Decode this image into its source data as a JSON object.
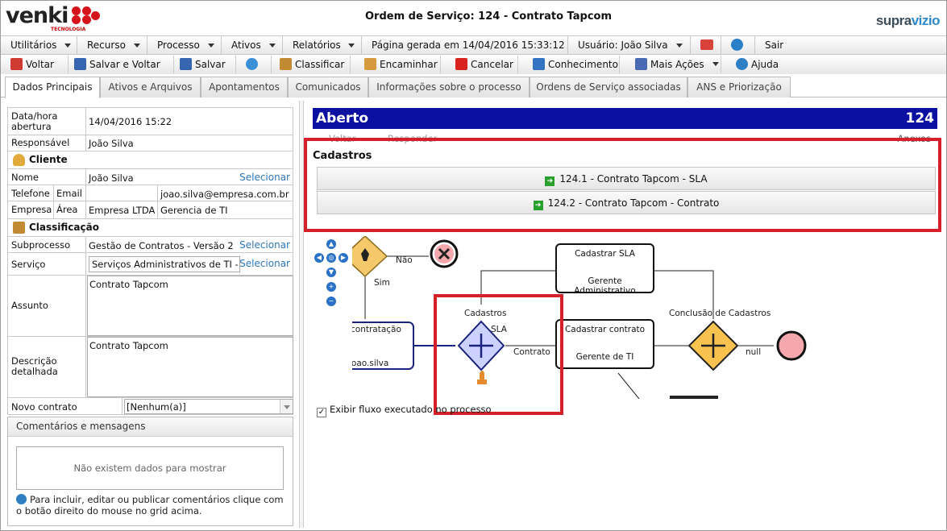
{
  "header": {
    "logo_text": "venki",
    "logo_sub": "TECNOLOGIA",
    "title": "Ordem de Serviço: 124 - Contrato Tapcom",
    "brand_a": "supra",
    "brand_b": "vizio"
  },
  "menu": {
    "items": [
      "Utilitários",
      "Recurso",
      "Processo",
      "Ativos",
      "Relatórios"
    ],
    "generated": "Página gerada em 14/04/2016 15:33:12",
    "user": "Usuário: João Silva",
    "exit": "Sair"
  },
  "toolbar": {
    "voltar": "Voltar",
    "salvar_voltar": "Salvar e Voltar",
    "salvar": "Salvar",
    "classificar": "Classificar",
    "encaminhar": "Encaminhar",
    "cancelar": "Cancelar",
    "conhecimento": "Conhecimento",
    "mais_acoes": "Mais Ações",
    "ajuda": "Ajuda"
  },
  "tabs": [
    "Dados Principais",
    "Ativos e Arquivos",
    "Apontamentos",
    "Comunicados",
    "Informações sobre o processo",
    "Ordens de Serviço associadas",
    "ANS e Priorização"
  ],
  "form": {
    "data_label": "Data/hora abertura",
    "data_value": "14/04/2016 15:22",
    "resp_label": "Responsável",
    "resp_value": "João Silva",
    "cliente": "Cliente",
    "nome_label": "Nome",
    "nome_value": "João Silva",
    "selecionar": "Selecionar",
    "tel_label": "Telefone",
    "email_label": "Email",
    "email_value": "joao.silva@empresa.com.br",
    "empresa_label": "Empresa",
    "area_label": "Área",
    "empresa_value": "Empresa LTDA",
    "area_value": "Gerencia de TI",
    "classificacao": "Classificação",
    "sub_label": "Subprocesso",
    "sub_value": "Gestão de Contratos - Versão 2",
    "serv_label": "Serviço",
    "serv_value": "Serviços Administrativos de TI -",
    "assunto_label": "Assunto",
    "assunto_value": "Contrato Tapcom",
    "desc_label": "Descrição detalhada",
    "desc_value": "Contrato Tapcom",
    "novo_label": "Novo contrato",
    "novo_value": "[Nenhum(a)]"
  },
  "comments": {
    "title": "Comentários e mensagens",
    "empty": "Não existem dados para mostrar",
    "hint": "Para incluir, editar ou publicar comentários clique com o botão direito do mouse no grid acima."
  },
  "panel": {
    "status": "Aberto",
    "number": "124",
    "voltar": "Voltar",
    "responder": "Responder",
    "anexos": "Anexos",
    "section": "Cadastros",
    "options": [
      "124.1 - Contrato Tapcom - SLA",
      "124.2 - Contrato Tapcom - Contrato"
    ]
  },
  "diagram": {
    "nao": "Não",
    "sim": "Sim",
    "cadastros": "Cadastros",
    "sla": "SLA",
    "contrato": "Contrato",
    "null": "null",
    "conclusao": "Conclusão de Cadastros",
    "task1_title": "Cadastrar SLA",
    "task1_role": "Gerente Administrativo",
    "task2_title": "Cadastrar contrato",
    "task2_role": "Gerente de TI",
    "task0_title": "contratação",
    "task0_role": "joao.silva"
  },
  "exibir": "Exibir fluxo executado no processo",
  "colors": {
    "accent": "#0c10a1",
    "highlight": "#d5202a",
    "link": "#2e76b8"
  }
}
